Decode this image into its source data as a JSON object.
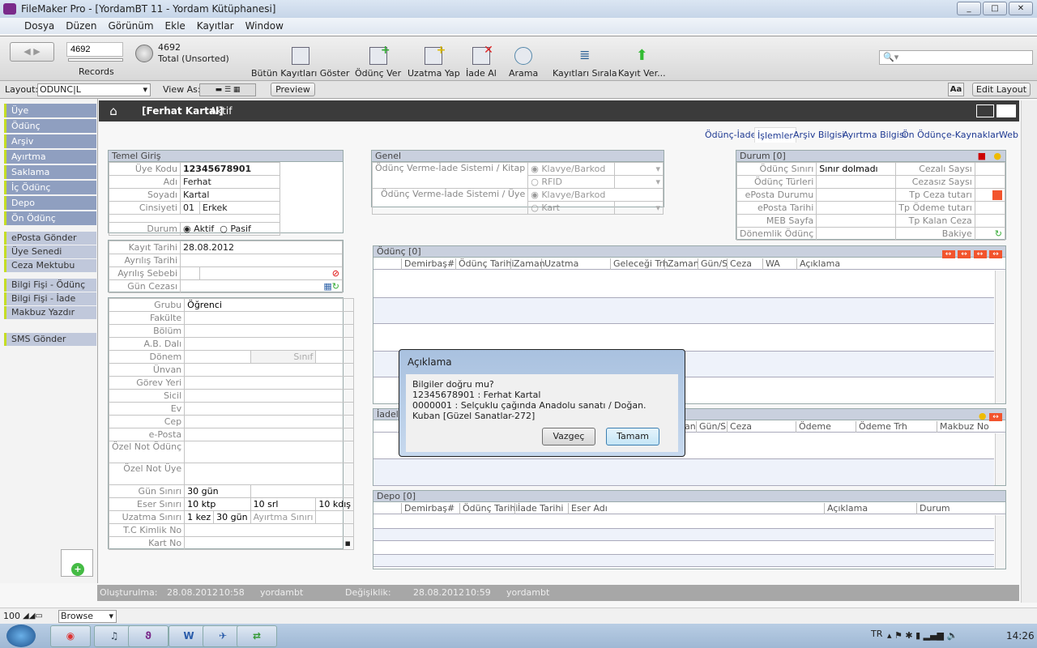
{
  "window": {
    "title": "FileMaker Pro - [YordamBT 11 - Yordam Kütüphanesi]"
  },
  "menu": [
    "Dosya",
    "Düzen",
    "Görünüm",
    "Ekle",
    "Kayıtlar",
    "Window"
  ],
  "toolbar": {
    "record_number": "4692",
    "records_label": "Records",
    "found_count": "4692",
    "total_label": "Total (Unsorted)",
    "buttons": [
      "Bütün Kayıtları Göster",
      "Ödünç Ver",
      "Uzatma Yap",
      "İade Al",
      "Arama",
      "Kayıtları Sırala",
      "Kayıt Ver..."
    ]
  },
  "layoutbar": {
    "layout_label": "Layout:",
    "layout_value": "ODUNC|L",
    "view_as": "View As:",
    "preview": "Preview",
    "aa": "Aa",
    "edit_layout": "Edit Layout"
  },
  "sidebar": {
    "main": [
      "Üye",
      "Ödünç",
      "Arşiv",
      "Ayırtma",
      "Saklama",
      "İç Ödünç",
      "Depo",
      "Ön Ödünç"
    ],
    "actions": [
      "ePosta Gönder",
      "Üye Senedi",
      "Ceza Mektubu",
      "Bilgi Fişi - Ödünç",
      "Bilgi Fişi - İade",
      "Makbuz Yazdır",
      "SMS Gönder"
    ]
  },
  "header": {
    "name": "[Ferhat Kartal]",
    "status": "Aktif"
  },
  "tabs": [
    "Ödünç-İade",
    "İşlemler",
    "Arşiv Bilgisi",
    "Ayırtma Bilgisi",
    "Ön Ödünç",
    "e-Kaynaklar",
    "Web"
  ],
  "temel": {
    "title": "Temel Giriş",
    "uye_kodu_label": "Üye Kodu",
    "uye_kodu": "12345678901",
    "adi_label": "Adı",
    "adi": "Ferhat",
    "soyadi_label": "Soyadı",
    "soyadi": "Kartal",
    "cinsiyet_label": "Cinsiyeti",
    "cinsiyet_kod": "01",
    "cinsiyet": "Erkek",
    "durum_label": "Durum",
    "aktif": "Aktif",
    "pasif": "Pasif",
    "kayit_label": "Kayıt Tarihi",
    "kayit": "28.08.2012",
    "ayrilis_label": "Ayrılış Tarihi",
    "sebep_label": "Ayrılış Sebebi",
    "gun_cezasi_label": "Gün Cezası"
  },
  "detay": {
    "grubu_label": "Grubu",
    "grubu": "Öğrenci",
    "fields": [
      "Fakülte",
      "Bölüm",
      "A.B. Dalı"
    ],
    "donem_label": "Dönem",
    "sinif_label": "Sınıf",
    "fields2": [
      "Ünvan",
      "Görev Yeri",
      "Sicil",
      "Ev",
      "Cep",
      "e-Posta"
    ],
    "ozel_odunc": "Özel Not Ödünç",
    "ozel_uye": "Özel Not Üye",
    "gun_siniri_label": "Gün Sınırı",
    "gun_siniri": "30 gün",
    "eser_label": "Eser Sınırı",
    "eser_ktp": "10 ktp",
    "eser_srl": "10 srl",
    "eser_kdis": "10 kdış",
    "uzatma_label": "Uzatma Sınırı",
    "uzatma_kez": "1 kez",
    "uzatma_gun": "30 gün",
    "ayirtma_label": "Ayırtma Sınırı",
    "tc_label": "T.C Kimlik No",
    "kart_label": "Kart No"
  },
  "genel": {
    "title": "Genel",
    "kitap_label": "Ödünç Verme-İade Sistemi / Kitap",
    "uye_label": "Ödünç Verme-İade Sistemi / Üye",
    "klavye": "Klavye/Barkod",
    "rfid": "RFID",
    "kart": "Kart"
  },
  "durum": {
    "title": "Durum [0]",
    "rows": [
      [
        "Ödünç Sınırı",
        "Sınır dolmadı",
        "Cezalı Saysı"
      ],
      [
        "Ödünç Türleri",
        "",
        "Cezasız Saysı"
      ],
      [
        "ePosta Durumu",
        "",
        "Tp Ceza tutarı"
      ],
      [
        "ePosta Tarihi",
        "",
        "Tp Ödeme tutarı"
      ],
      [
        "MEB Sayfa",
        "",
        "Tp Kalan Ceza"
      ],
      [
        "Dönemlik Ödünç",
        "",
        "Bakiye"
      ]
    ]
  },
  "odunc": {
    "title": "Ödünç [0]",
    "columns": [
      "Demirbaş#",
      "Ödünç Tarihi",
      "Zaman",
      "Uzatma",
      "Geleceği Trh",
      "Zaman",
      "Gün/S",
      "Ceza",
      "WA",
      "Açıklama"
    ]
  },
  "iadeler": {
    "title": "İadeler",
    "columns": [
      "Zaman",
      "Gün/S",
      "Ceza",
      "Ödeme",
      "Ödeme Trh",
      "Makbuz No"
    ]
  },
  "depo": {
    "title": "Depo [0]",
    "columns": [
      "Demirbaş#",
      "Ödünç Tarihi",
      "İade Tarihi",
      "Eser Adı",
      "Açıklama",
      "Durum"
    ]
  },
  "dialog": {
    "title": "Açıklama",
    "line1": "Bilgiler doğru mu?",
    "line2": "12345678901 : Ferhat Kartal",
    "line3": "0000001 : Selçuklu çağında Anadolu sanatı / Doğan. Kuban  [Güzel Sanatlar-272]",
    "cancel": "Vazgeç",
    "ok": "Tamam"
  },
  "footer": {
    "created_label": "Oluşturulma:",
    "created_date": "28.08.2012",
    "created_time": "10:58",
    "created_user": "yordambt",
    "modified_label": "Değişiklik:",
    "modified_date": "28.08.2012",
    "modified_time": "10:59",
    "modified_user": "yordambt"
  },
  "bottombar": {
    "zoom": "100",
    "mode": "Browse"
  },
  "taskbar": {
    "lang": "TR",
    "clock": "14:26"
  },
  "colors": {
    "sidebar_item": "#8f9fc0",
    "accent_stripe": "#c5dd24",
    "header_bar": "#3b3b3b",
    "panel_header": "#c9d0de",
    "warning": "#f2542d"
  }
}
